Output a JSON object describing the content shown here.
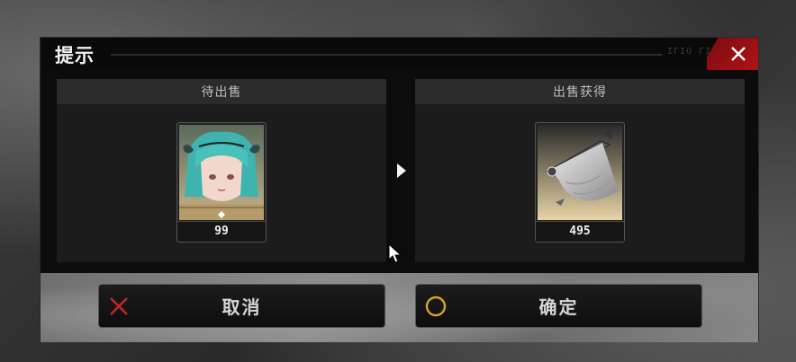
{
  "dialog": {
    "title": "提示",
    "title_deco": "ΙΓΙΟ ΓΙ ΙİΚ",
    "close_label": "×"
  },
  "panels": {
    "pending": {
      "header": "待出售",
      "item": {
        "icon": "character-portrait-icon",
        "quantity": "99"
      }
    },
    "gain": {
      "header": "出售获得",
      "item": {
        "icon": "flag-banner-material-icon",
        "quantity": "495"
      }
    }
  },
  "buttons": {
    "cancel": {
      "label": "取消",
      "icon": "x-cross-icon",
      "icon_color": "#c0282a"
    },
    "confirm": {
      "label": "确定",
      "icon": "circle-icon",
      "icon_color": "#d9a520"
    }
  },
  "colors": {
    "accent_red": "#b01218",
    "panel_bg": "#1c1c1c",
    "header_bg": "#2b2b2b"
  }
}
